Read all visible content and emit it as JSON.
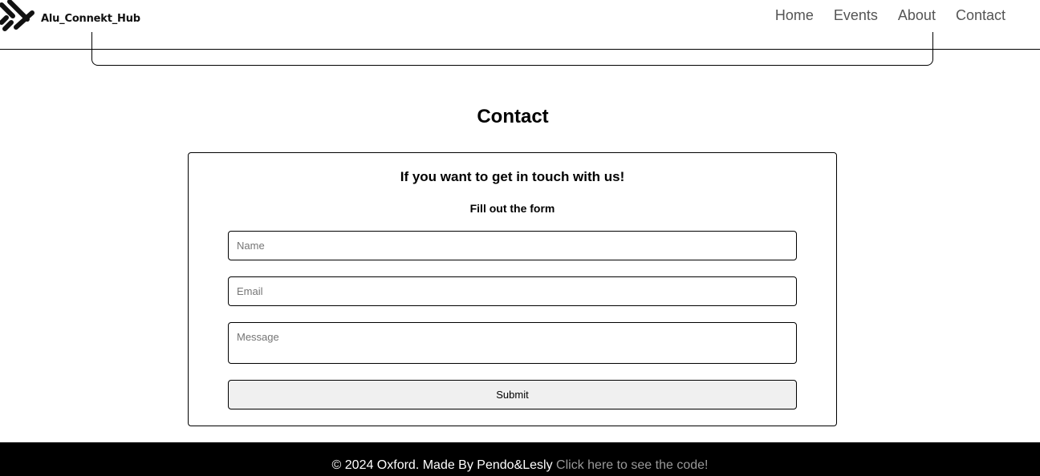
{
  "header": {
    "logo_text": "Alu_Connekt_Hub",
    "nav": [
      {
        "label": "Home"
      },
      {
        "label": "Events"
      },
      {
        "label": "About"
      },
      {
        "label": "Contact"
      }
    ]
  },
  "contact": {
    "title": "Contact",
    "heading": "If you want to get in touch with us!",
    "subheading": "Fill out the form",
    "name_placeholder": "Name",
    "email_placeholder": "Email",
    "message_placeholder": "Message",
    "submit_label": "Submit"
  },
  "footer": {
    "copyright": "© 2024 Oxford. Made By Pendo&Lesly ",
    "code_link": "Click here to see the code!"
  },
  "colors": {
    "footer_bg": "#000000",
    "footer_link": "#999999",
    "nav_text": "#555555",
    "button_bg": "#f0f0f0"
  }
}
